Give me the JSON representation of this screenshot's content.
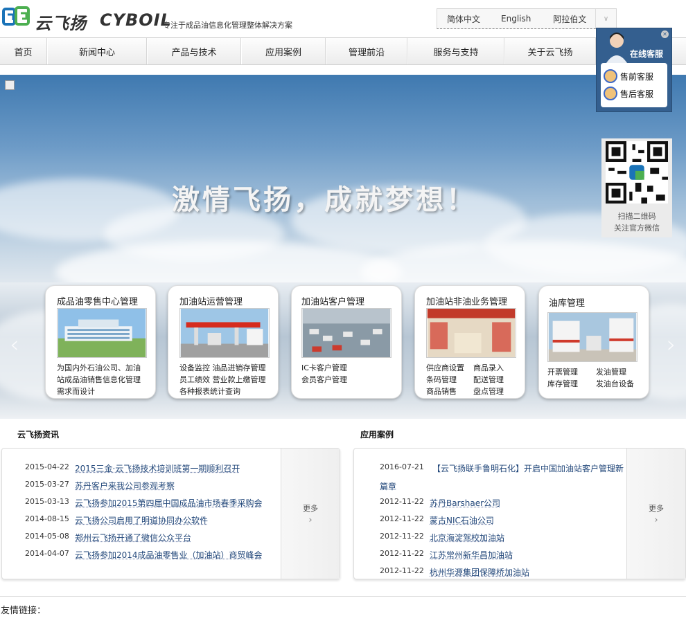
{
  "brand": {
    "name_cn": "云飞扬",
    "name_en": "CYBOIL",
    "slogan": "专注于成品油信息化管理整体解决方案",
    "primary_color": "#1a73b8",
    "accent_green": "#4caf50"
  },
  "languages": [
    "简体中文",
    "English",
    "阿拉伯文"
  ],
  "nav": [
    "首页",
    "新闻中心",
    "产品与技术",
    "应用案例",
    "管理前沿",
    "服务与支持",
    "关于云飞扬"
  ],
  "banner": {
    "headline": "激情飞扬，成就梦想！"
  },
  "service": {
    "title": "在线客服",
    "items": [
      "售前客服",
      "售后客服"
    ]
  },
  "qr": {
    "line1": "扫描二维码",
    "line2": "关注官方微信"
  },
  "cards": [
    {
      "title": "成品油零售中心管理",
      "desc": [
        "为国内外石油公司、加油",
        "站成品油销售信息化管理",
        "需求而设计"
      ]
    },
    {
      "title": "加油站运营管理",
      "desc": [
        "设备监控  油品进销存管理",
        "员工绩效  营业款上缴管理",
        "各种报表统计查询"
      ]
    },
    {
      "title": "加油站客户管理",
      "desc": [
        "IC卡客户管理",
        "会员客户管理"
      ]
    },
    {
      "title": "加油站非油业务管理",
      "items": [
        "供应商设置",
        "商品录入",
        "条码管理",
        "配送管理",
        "商品销售",
        "盘点管理"
      ]
    },
    {
      "title": "油库管理",
      "items": [
        "开票管理",
        "发油管理",
        "库存管理",
        "发油台设备"
      ]
    }
  ],
  "news": {
    "title": "云飞扬资讯",
    "more": "更多",
    "rows": [
      {
        "date": "2015-04-22",
        "text": "2015三金·云飞扬技术培训班第一期顺利召开"
      },
      {
        "date": "2015-03-27",
        "text": "苏丹客户来我公司参观考察"
      },
      {
        "date": "2015-03-13",
        "text": "云飞扬参加2015第四届中国成品油市场春季采购会"
      },
      {
        "date": "2014-08-15",
        "text": "云飞扬公司启用了明道协同办公软件"
      },
      {
        "date": "2014-05-08",
        "text": "郑州云飞扬开通了微信公众平台"
      },
      {
        "date": "2014-04-07",
        "text": "云飞扬参加2014成品油零售业（加油站）商贸峰会"
      }
    ]
  },
  "cases": {
    "title": "应用案例",
    "more": "更多",
    "first": {
      "date": "2016-07-21",
      "text1": "【云飞扬联手鲁明石化】开启中国加油站客户管理新",
      "text2": "篇章"
    },
    "rows": [
      {
        "date": "2012-11-22",
        "text": "苏丹Barshaer公司"
      },
      {
        "date": "2012-11-22",
        "text": "蒙古NIC石油公司"
      },
      {
        "date": "2012-11-22",
        "text": "北京海淀驾校加油站"
      },
      {
        "date": "2012-11-22",
        "text": "江苏常州新华昌加油站"
      },
      {
        "date": "2012-11-22",
        "text": "杭州华源集团保障桥加油站"
      }
    ]
  },
  "footer": {
    "friends": "友情链接："
  }
}
